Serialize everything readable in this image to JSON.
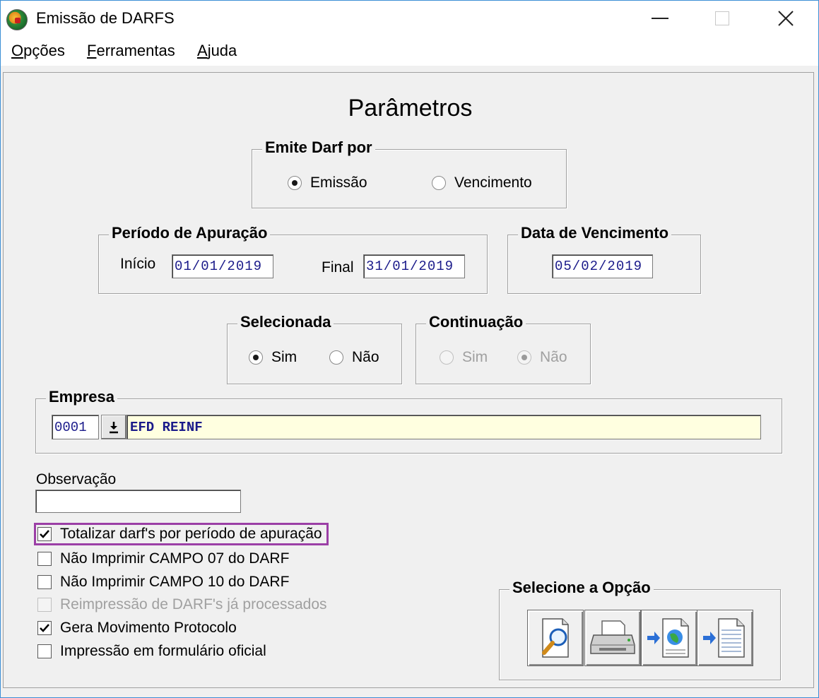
{
  "window": {
    "title": "Emissão de DARFS"
  },
  "menu": {
    "items": [
      {
        "prefix": "",
        "accel": "O",
        "rest": "pções"
      },
      {
        "prefix": "",
        "accel": "F",
        "rest": "erramentas"
      },
      {
        "prefix": "",
        "accel": "A",
        "rest": "juda"
      }
    ]
  },
  "form": {
    "heading": "Parâmetros",
    "emite_darf": {
      "legend": "Emite Darf por",
      "options": [
        "Emissão",
        "Vencimento"
      ],
      "selected": "Emissão"
    },
    "periodo": {
      "legend": "Período de Apuração",
      "inicio_label": "Início",
      "inicio_value": "01/01/2019",
      "final_label": "Final",
      "final_value": "31/01/2019"
    },
    "vencimento": {
      "legend": "Data de Vencimento",
      "value": "05/02/2019"
    },
    "selecionada": {
      "legend": "Selecionada",
      "options": [
        "Sim",
        "Não"
      ],
      "selected": "Sim"
    },
    "continuacao": {
      "legend": "Continuação",
      "options": [
        "Sim",
        "Não"
      ],
      "selected": "Não",
      "disabled": true
    },
    "empresa": {
      "legend": "Empresa",
      "code": "0001",
      "name": "EFD REINF"
    },
    "observacao": {
      "label": "Observação",
      "value": ""
    },
    "checks": [
      {
        "label": "Totalizar darf's por período de apuração",
        "checked": true,
        "disabled": false,
        "highlighted": true
      },
      {
        "label": "Não Imprimir CAMPO 07 do DARF",
        "checked": false,
        "disabled": false
      },
      {
        "label": "Não Imprimir CAMPO 10 do DARF",
        "checked": false,
        "disabled": false
      },
      {
        "label": "Reimpressão de DARF's já processados",
        "checked": false,
        "disabled": true
      },
      {
        "label": "Gera Movimento Protocolo",
        "checked": true,
        "disabled": false
      },
      {
        "label": "Impressão em formulário oficial",
        "checked": false,
        "disabled": false
      }
    ],
    "opcao": {
      "legend": "Selecione a Opção",
      "buttons": [
        "preview-icon",
        "printer-icon",
        "export-web-icon",
        "export-file-icon"
      ]
    }
  },
  "colors": {
    "highlight": "#9b3fa6",
    "field_text": "#1a1a8a",
    "empresa_bg": "#ffffe0"
  }
}
